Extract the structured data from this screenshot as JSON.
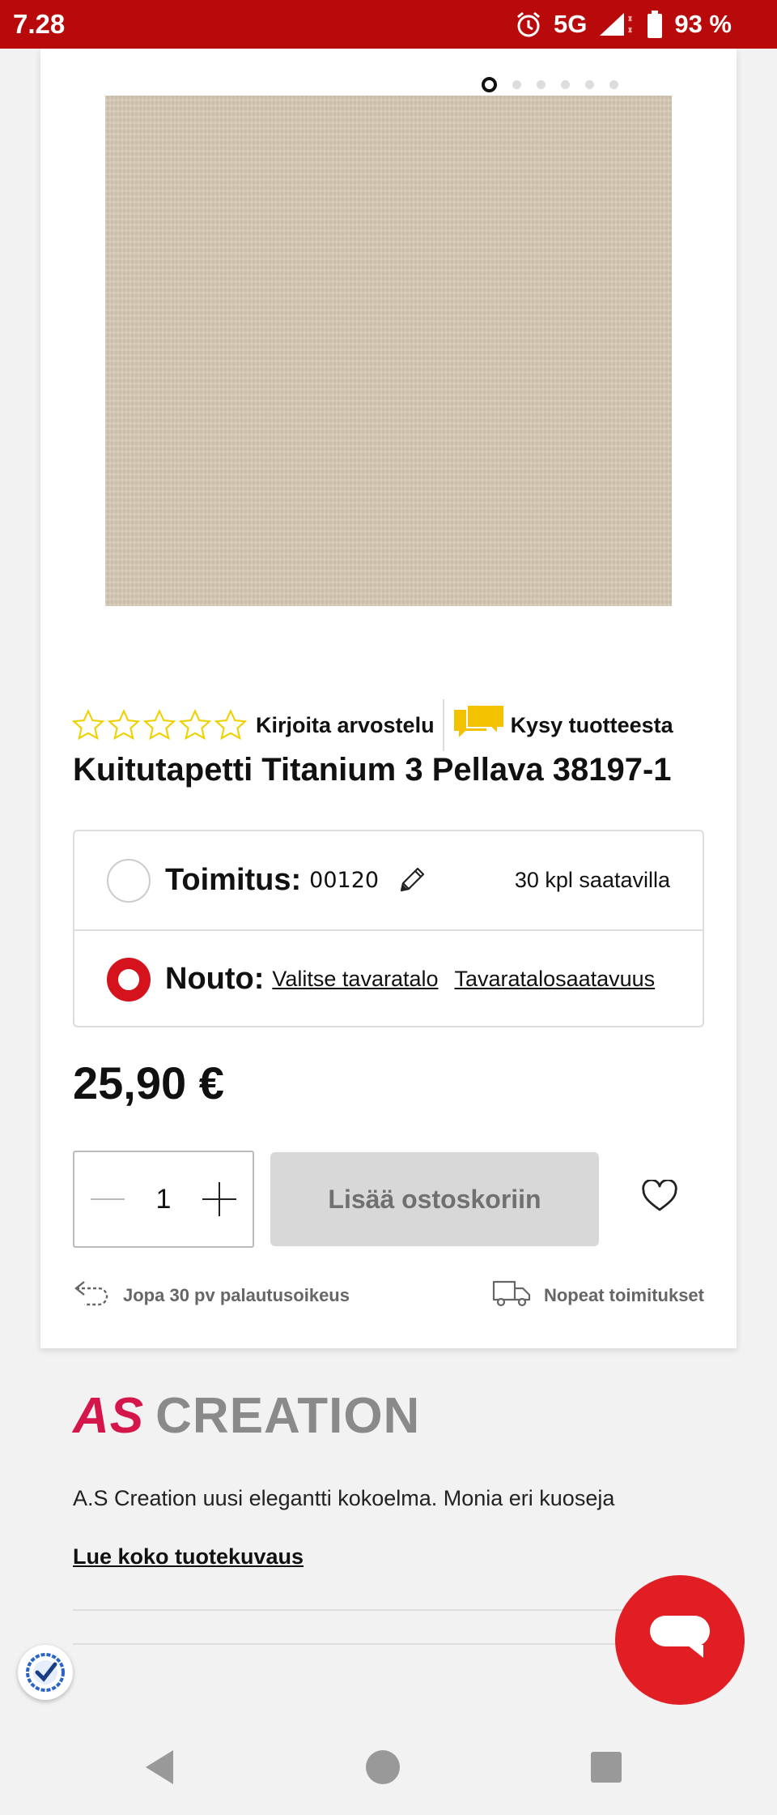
{
  "status_bar": {
    "time": "7.28",
    "network": "5G",
    "battery": "93 %"
  },
  "gallery": {
    "image_count": 6,
    "active_index": 0
  },
  "product": {
    "rating_stars": 0,
    "review_link": "Kirjoita arvostelu",
    "ask_link": "Kysy tuotteesta",
    "title": "Kuitutapetti Titanium 3 Pellava 38197-1",
    "delivery": {
      "label": "Toimitus:",
      "postal_code": "00120",
      "stock": "30 kpl saatavilla"
    },
    "pickup": {
      "label": "Nouto:",
      "choose_store": "Valitse tavaratalo",
      "store_availability": "Tavaratalosaatavuus"
    },
    "price": "25,90 €",
    "quantity": "1",
    "add_to_cart": "Lisää ostoskoriin",
    "perks": {
      "returns": "Jopa 30 pv palautusoikeus",
      "delivery": "Nopeat toimitukset"
    }
  },
  "brand": {
    "logo_part1": "AS",
    "logo_part2": "CREATION",
    "description": "A.S Creation uusi elegantti kokoelma. Monia eri kuoseja",
    "read_more": "Lue koko tuotekuvaus"
  },
  "colors": {
    "status_bar": "#b80a0a",
    "accent_red": "#d4131d",
    "chat_button": "#e01e24",
    "star_outline": "#f0d000",
    "chat_icon": "#f2c200",
    "brand_red": "#d4164b",
    "brand_gray": "#8a8a8a",
    "image_fill": "#d6c9b3"
  },
  "icons": {
    "status": [
      "alarm-icon",
      "signal-icon",
      "battery-icon"
    ],
    "review": "star-icon",
    "ask": "chat-bubbles-icon",
    "edit": "pencil-icon",
    "wishlist": "heart-icon",
    "returns": "return-arrow-icon",
    "shipping": "truck-icon",
    "trust": "check-badge-icon",
    "chat": "chat-icon",
    "nav": [
      "back-icon",
      "home-icon",
      "recent-apps-icon"
    ]
  }
}
